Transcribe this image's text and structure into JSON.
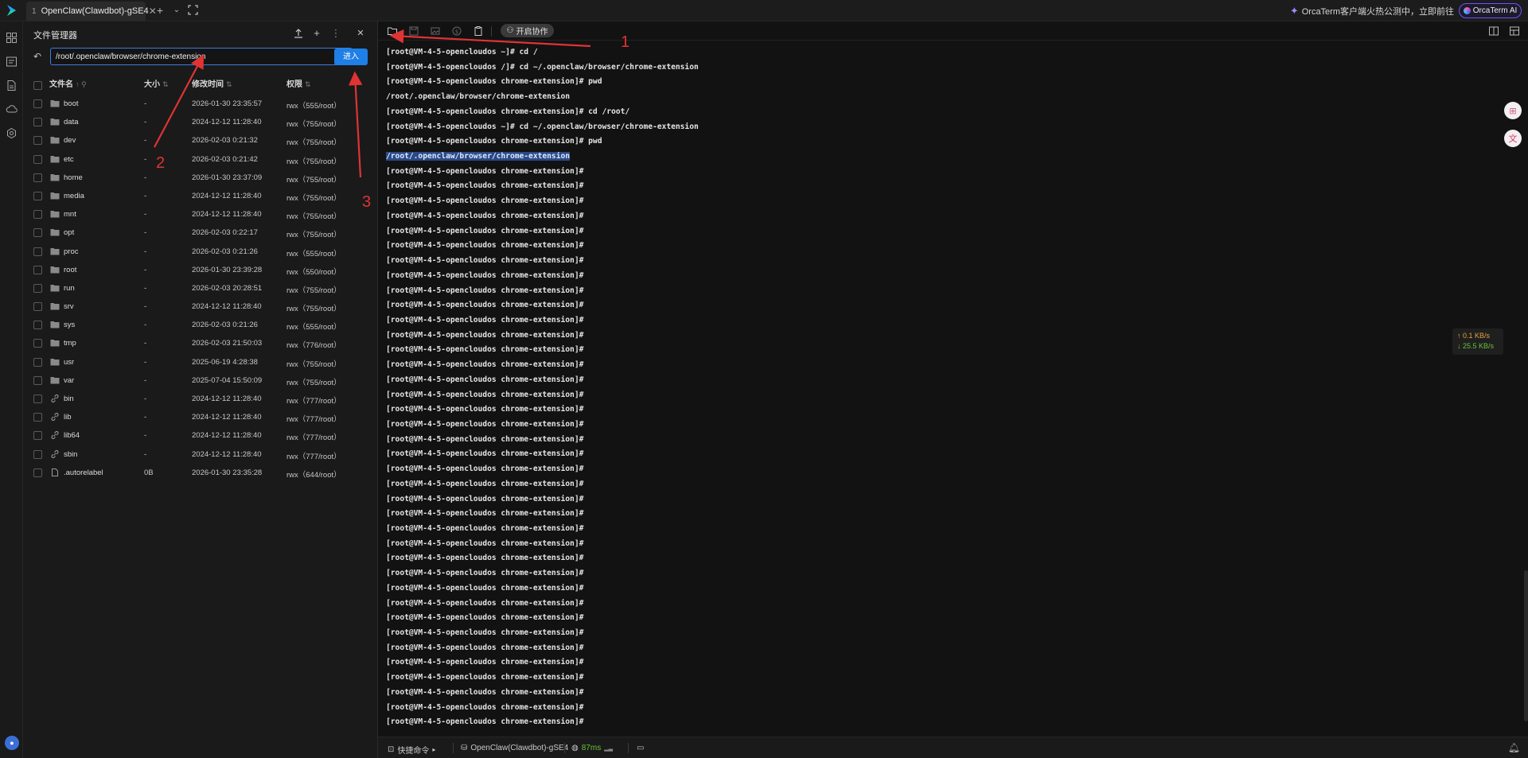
{
  "topbar": {
    "tab_index": "1",
    "tab_title": "OpenClaw(Clawdbot)-gSE4",
    "promo_text": "OrcaTerm客户端火热公测中，立即前往",
    "ai_button": "OrcaTerm AI"
  },
  "file_manager": {
    "title": "文件管理器",
    "path": "/root/.openclaw/browser/chrome-extension",
    "go_button": "进入",
    "columns": {
      "name": "文件名",
      "size": "大小",
      "mtime": "修改时间",
      "perm": "权限"
    },
    "rows": [
      {
        "type": "folder",
        "name": "boot",
        "size": "-",
        "mtime": "2026-01-30 23:35:57",
        "perm": "rwx（555/root）"
      },
      {
        "type": "folder",
        "name": "data",
        "size": "-",
        "mtime": "2024-12-12 11:28:40",
        "perm": "rwx（755/root）"
      },
      {
        "type": "folder",
        "name": "dev",
        "size": "-",
        "mtime": "2026-02-03 0:21:32",
        "perm": "rwx（755/root）"
      },
      {
        "type": "folder",
        "name": "etc",
        "size": "-",
        "mtime": "2026-02-03 0:21:42",
        "perm": "rwx（755/root）"
      },
      {
        "type": "folder",
        "name": "home",
        "size": "-",
        "mtime": "2026-01-30 23:37:09",
        "perm": "rwx（755/root）"
      },
      {
        "type": "folder",
        "name": "media",
        "size": "-",
        "mtime": "2024-12-12 11:28:40",
        "perm": "rwx（755/root）"
      },
      {
        "type": "folder",
        "name": "mnt",
        "size": "-",
        "mtime": "2024-12-12 11:28:40",
        "perm": "rwx（755/root）"
      },
      {
        "type": "folder",
        "name": "opt",
        "size": "-",
        "mtime": "2026-02-03 0:22:17",
        "perm": "rwx（755/root）"
      },
      {
        "type": "folder",
        "name": "proc",
        "size": "-",
        "mtime": "2026-02-03 0:21:26",
        "perm": "rwx（555/root）"
      },
      {
        "type": "folder",
        "name": "root",
        "size": "-",
        "mtime": "2026-01-30 23:39:28",
        "perm": "rwx（550/root）"
      },
      {
        "type": "folder",
        "name": "run",
        "size": "-",
        "mtime": "2026-02-03 20:28:51",
        "perm": "rwx（755/root）"
      },
      {
        "type": "folder",
        "name": "srv",
        "size": "-",
        "mtime": "2024-12-12 11:28:40",
        "perm": "rwx（755/root）"
      },
      {
        "type": "folder",
        "name": "sys",
        "size": "-",
        "mtime": "2026-02-03 0:21:26",
        "perm": "rwx（555/root）"
      },
      {
        "type": "folder",
        "name": "tmp",
        "size": "-",
        "mtime": "2026-02-03 21:50:03",
        "perm": "rwx（776/root）"
      },
      {
        "type": "folder",
        "name": "usr",
        "size": "-",
        "mtime": "2025-06-19 4:28:38",
        "perm": "rwx（755/root）"
      },
      {
        "type": "folder",
        "name": "var",
        "size": "-",
        "mtime": "2025-07-04 15:50:09",
        "perm": "rwx（755/root）"
      },
      {
        "type": "link",
        "name": "bin",
        "size": "-",
        "mtime": "2024-12-12 11:28:40",
        "perm": "rwx（777/root）"
      },
      {
        "type": "link",
        "name": "lib",
        "size": "-",
        "mtime": "2024-12-12 11:28:40",
        "perm": "rwx（777/root）"
      },
      {
        "type": "link",
        "name": "lib64",
        "size": "-",
        "mtime": "2024-12-12 11:28:40",
        "perm": "rwx（777/root）"
      },
      {
        "type": "link",
        "name": "sbin",
        "size": "-",
        "mtime": "2024-12-12 11:28:40",
        "perm": "rwx（777/root）"
      },
      {
        "type": "file",
        "name": ".autorelabel",
        "size": "0B",
        "mtime": "2026-01-30 23:35:28",
        "perm": "rwx（644/root）"
      }
    ]
  },
  "terminal": {
    "collab_button": "开启协作",
    "lines": [
      {
        "text": "[root@VM-4-5-opencloudos ~]# cd /"
      },
      {
        "text": "[root@VM-4-5-opencloudos /]# cd ~/.openclaw/browser/chrome-extension"
      },
      {
        "text": "[root@VM-4-5-opencloudos chrome-extension]# pwd"
      },
      {
        "text": "/root/.openclaw/browser/chrome-extension"
      },
      {
        "text": "[root@VM-4-5-opencloudos chrome-extension]# cd /root/"
      },
      {
        "text": "[root@VM-4-5-opencloudos ~]# cd ~/.openclaw/browser/chrome-extension"
      },
      {
        "text": "[root@VM-4-5-opencloudos chrome-extension]# pwd"
      },
      {
        "text": "/root/.openclaw/browser/chrome-extension",
        "highlight": true
      },
      {
        "text": "[root@VM-4-5-opencloudos chrome-extension]#"
      },
      {
        "text": "[root@VM-4-5-opencloudos chrome-extension]#"
      },
      {
        "text": "[root@VM-4-5-opencloudos chrome-extension]#"
      },
      {
        "text": "[root@VM-4-5-opencloudos chrome-extension]#"
      },
      {
        "text": "[root@VM-4-5-opencloudos chrome-extension]#"
      },
      {
        "text": "[root@VM-4-5-opencloudos chrome-extension]#"
      },
      {
        "text": "[root@VM-4-5-opencloudos chrome-extension]#"
      },
      {
        "text": "[root@VM-4-5-opencloudos chrome-extension]#"
      },
      {
        "text": "[root@VM-4-5-opencloudos chrome-extension]#"
      },
      {
        "text": "[root@VM-4-5-opencloudos chrome-extension]#"
      },
      {
        "text": "[root@VM-4-5-opencloudos chrome-extension]#"
      },
      {
        "text": "[root@VM-4-5-opencloudos chrome-extension]#"
      },
      {
        "text": "[root@VM-4-5-opencloudos chrome-extension]#"
      },
      {
        "text": "[root@VM-4-5-opencloudos chrome-extension]#"
      },
      {
        "text": "[root@VM-4-5-opencloudos chrome-extension]#"
      },
      {
        "text": "[root@VM-4-5-opencloudos chrome-extension]#"
      },
      {
        "text": "[root@VM-4-5-opencloudos chrome-extension]#"
      },
      {
        "text": "[root@VM-4-5-opencloudos chrome-extension]#"
      },
      {
        "text": "[root@VM-4-5-opencloudos chrome-extension]#"
      },
      {
        "text": "[root@VM-4-5-opencloudos chrome-extension]#"
      },
      {
        "text": "[root@VM-4-5-opencloudos chrome-extension]#"
      },
      {
        "text": "[root@VM-4-5-opencloudos chrome-extension]#"
      },
      {
        "text": "[root@VM-4-5-opencloudos chrome-extension]#"
      },
      {
        "text": "[root@VM-4-5-opencloudos chrome-extension]#"
      },
      {
        "text": "[root@VM-4-5-opencloudos chrome-extension]#"
      },
      {
        "text": "[root@VM-4-5-opencloudos chrome-extension]#"
      },
      {
        "text": "[root@VM-4-5-opencloudos chrome-extension]#"
      },
      {
        "text": "[root@VM-4-5-opencloudos chrome-extension]#"
      },
      {
        "text": "[root@VM-4-5-opencloudos chrome-extension]#"
      },
      {
        "text": "[root@VM-4-5-opencloudos chrome-extension]#"
      },
      {
        "text": "[root@VM-4-5-opencloudos chrome-extension]#"
      },
      {
        "text": "[root@VM-4-5-opencloudos chrome-extension]#"
      },
      {
        "text": "[root@VM-4-5-opencloudos chrome-extension]#"
      },
      {
        "text": "[root@VM-4-5-opencloudos chrome-extension]#"
      },
      {
        "text": "[root@VM-4-5-opencloudos chrome-extension]#"
      },
      {
        "text": "[root@VM-4-5-opencloudos chrome-extension]#"
      },
      {
        "text": "[root@VM-4-5-opencloudos chrome-extension]#"
      },
      {
        "text": "[root@VM-4-5-opencloudos chrome-extension]#"
      }
    ],
    "net_up": "↑ 0.1 KB/s",
    "net_down": "↓ 25.5 KB/s"
  },
  "statusbar": {
    "quick_cmd": "快捷命令",
    "session": "OpenClaw(Clawdbot)-gSE4",
    "latency": "87ms"
  },
  "annotations": [
    "1",
    "2",
    "3"
  ],
  "colors": {
    "accent": "#1e7fe6",
    "annotation": "#e03333",
    "terminal_bg": "#121212"
  },
  "icons": [
    "folder-icon",
    "link-icon",
    "file-icon",
    "upload-icon",
    "plus-icon",
    "more-icon",
    "close-icon",
    "refresh-icon",
    "split-icon",
    "bell-icon"
  ]
}
